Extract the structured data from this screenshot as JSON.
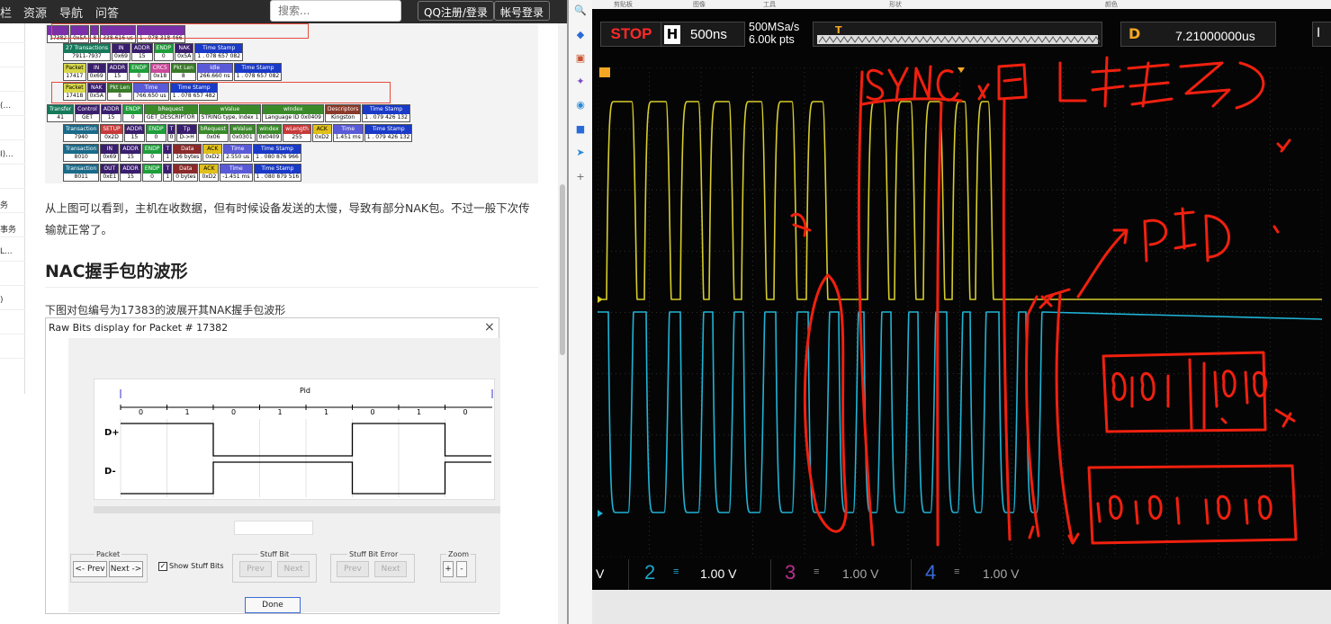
{
  "browser": {
    "nav": [
      "栏",
      "资源",
      "导航",
      "问答"
    ],
    "search_placeholder": "搜索...",
    "qq_login": "QQ注册/登录",
    "account_login": "帐号登录",
    "sidebar_items": [
      "",
      "",
      "",
      "(...",
      "",
      "I)...",
      "",
      "务",
      "事务",
      "L...",
      "",
      ")",
      "",
      ""
    ]
  },
  "article": {
    "trace_rows": [
      {
        "cells": [
          {
            "h": "",
            "v": "17382",
            "c": "#7b2fa8"
          },
          {
            "h": "",
            "v": "0x5A",
            "c": "#7b2fa8"
          },
          {
            "h": "",
            "v": "8",
            "c": "#7b2fa8"
          },
          {
            "h": "",
            "v": "338.616 us",
            "c": "#7b2fa8"
          },
          {
            "h": "",
            "v": "1 . 078 318 466",
            "c": "#7b2fa8"
          }
        ]
      },
      {
        "cells": [
          {
            "h": "27 Transactions",
            "v": "7911-7937",
            "c": "#167a5a"
          },
          {
            "h": "IN",
            "v": "0x69",
            "c": "#3a1e6e"
          },
          {
            "h": "ADDR",
            "v": "15",
            "c": "#3a1e6e"
          },
          {
            "h": "ENDP",
            "v": "0",
            "c": "#1e9e3a"
          },
          {
            "h": "NAK",
            "v": "0x5A",
            "c": "#3a1e6e"
          },
          {
            "h": "Time Stamp",
            "v": "1 . 078 657 082",
            "c": "#1a3ac8"
          }
        ]
      },
      {
        "cells": [
          {
            "h": "Packet",
            "v": "17417",
            "c": "#d8d84a"
          },
          {
            "h": "IN",
            "v": "0x69",
            "c": "#3a1e6e"
          },
          {
            "h": "ADDR",
            "v": "15",
            "c": "#3a1e6e"
          },
          {
            "h": "ENDP",
            "v": "0",
            "c": "#1e9e3a"
          },
          {
            "h": "CRC5",
            "v": "0x18",
            "c": "#c94a9a"
          },
          {
            "h": "Pkt Len",
            "v": "8",
            "c": "#3a7a2a"
          },
          {
            "h": "Idle",
            "v": "266.660 ns",
            "c": "#5a5ad8"
          },
          {
            "h": "Time Stamp",
            "v": "1 . 078 657 082",
            "c": "#1a3ac8"
          }
        ]
      },
      {
        "cells": [
          {
            "h": "Packet",
            "v": "17418",
            "c": "#d8d84a"
          },
          {
            "h": "NAK",
            "v": "0x5A",
            "c": "#3a1e6e"
          },
          {
            "h": "Pkt Len",
            "v": "8",
            "c": "#3a7a2a"
          },
          {
            "h": "Time",
            "v": "766.650 us",
            "c": "#5a5ad8"
          },
          {
            "h": "Time Stamp",
            "v": "1 . 078 657 482",
            "c": "#1a3ac8"
          }
        ]
      },
      {
        "cells": [
          {
            "h": "Transfer",
            "v": "41",
            "c": "#167a5a"
          },
          {
            "h": "Control",
            "v": "GET",
            "c": "#3a1e6e"
          },
          {
            "h": "ADDR",
            "v": "15",
            "c": "#3a1e6e"
          },
          {
            "h": "ENDP",
            "v": "0",
            "c": "#1e9e3a"
          },
          {
            "h": "bRequest",
            "v": "GET_DESCRIPTOR",
            "c": "#3a8a2a"
          },
          {
            "h": "wValue",
            "v": "STRING type, Index 1",
            "c": "#3a8a2a"
          },
          {
            "h": "wIndex",
            "v": "Language ID 0x0409",
            "c": "#3a8a2a"
          },
          {
            "h": "Descriptors",
            "v": "Kingston",
            "c": "#8a3a2a"
          },
          {
            "h": "Time Stamp",
            "v": "1 . 079 426 132",
            "c": "#1a3ac8"
          }
        ]
      },
      {
        "cells": [
          {
            "h": "Transaction",
            "v": "7940",
            "c": "#1a6a8a"
          },
          {
            "h": "SETUP",
            "v": "0x2D",
            "c": "#c83a3a"
          },
          {
            "h": "ADDR",
            "v": "15",
            "c": "#3a1e6e"
          },
          {
            "h": "ENDP",
            "v": "0",
            "c": "#1e9e3a"
          },
          {
            "h": "T",
            "v": "0",
            "c": "#3a1e6e"
          },
          {
            "h": "Tp",
            "v": "D->H",
            "c": "#3a1e6e"
          },
          {
            "h": "bRequest",
            "v": "0x06",
            "c": "#3a8a2a"
          },
          {
            "h": "wValue",
            "v": "0x0301",
            "c": "#3a8a2a"
          },
          {
            "h": "wIndex",
            "v": "0x0409",
            "c": "#3a8a2a"
          },
          {
            "h": "wLength",
            "v": "255",
            "c": "#c83a3a"
          },
          {
            "h": "ACK",
            "v": "0xD2",
            "c": "#e0c01a"
          },
          {
            "h": "Time",
            "v": "1.451 ms",
            "c": "#5a5ad8"
          },
          {
            "h": "Time Stamp",
            "v": "1 . 079 426 132",
            "c": "#1a3ac8"
          }
        ]
      },
      {
        "cells": [
          {
            "h": "Transaction",
            "v": "8010",
            "c": "#1a6a8a"
          },
          {
            "h": "IN",
            "v": "0x69",
            "c": "#3a1e6e"
          },
          {
            "h": "ADDR",
            "v": "15",
            "c": "#3a1e6e"
          },
          {
            "h": "ENDP",
            "v": "0",
            "c": "#1e9e3a"
          },
          {
            "h": "T",
            "v": "1",
            "c": "#3a1e6e"
          },
          {
            "h": "Data",
            "v": "16 bytes",
            "c": "#8a2a2a"
          },
          {
            "h": "ACK",
            "v": "0xD2",
            "c": "#e0c01a"
          },
          {
            "h": "Time",
            "v": "2.550 us",
            "c": "#5a5ad8"
          },
          {
            "h": "Time Stamp",
            "v": "1 . 080 876 966",
            "c": "#1a3ac8"
          }
        ]
      },
      {
        "cells": [
          {
            "h": "Transaction",
            "v": "8011",
            "c": "#1a6a8a"
          },
          {
            "h": "OUT",
            "v": "0xE1",
            "c": "#3a1e6e"
          },
          {
            "h": "ADDR",
            "v": "15",
            "c": "#3a1e6e"
          },
          {
            "h": "ENDP",
            "v": "0",
            "c": "#1e9e3a"
          },
          {
            "h": "T",
            "v": "1",
            "c": "#3a1e6e"
          },
          {
            "h": "Data",
            "v": "0 bytes",
            "c": "#8a2a2a"
          },
          {
            "h": "ACK",
            "v": "0xD2",
            "c": "#e0c01a"
          },
          {
            "h": "Time",
            "v": "-1.451 ms",
            "c": "#5a5ad8"
          },
          {
            "h": "Time Stamp",
            "v": "1 . 080 879 516",
            "c": "#1a3ac8"
          }
        ]
      }
    ],
    "para1": "从上图可以看到，主机在收数据，但有时候设备发送的太慢，导致有部分NAK包。不过一般下次传输就正常了。",
    "heading": "NAC握手包的波形",
    "para2": "下图对包编号为17383的波展开其NAK握手包波形"
  },
  "dialog": {
    "title": "Raw Bits display for Packet # 17382",
    "close": "×",
    "pid_label": "Pid",
    "bits": [
      "0",
      "1",
      "0",
      "1",
      "1",
      "0",
      "1",
      "0"
    ],
    "d_plus": "D+",
    "d_minus": "D-",
    "groups": {
      "packet": {
        "title": "Packet",
        "prev": "<- Prev",
        "next": "Next ->"
      },
      "show_stuff": "Show Stuff Bits",
      "stuff_bit": {
        "title": "Stuff Bit",
        "prev": "Prev",
        "next": "Next"
      },
      "stuff_err": {
        "title": "Stuff Bit Error",
        "prev": "Prev",
        "next": "Next"
      },
      "zoom": {
        "title": "Zoom",
        "plus": "+",
        "minus": "-"
      }
    },
    "done": "Done"
  },
  "scope": {
    "menu": [
      "剪贴板",
      "图像",
      "工具",
      "形状",
      "颜色"
    ],
    "run_state": "STOP",
    "h_label": "H",
    "timebase": "500ns",
    "sample_rate": "500MSa/s",
    "points": "6.00k pts",
    "delay_label": "D",
    "delay": "7.21000000us",
    "channels": [
      {
        "num": "2",
        "scale": "1.00 V",
        "color": "#1fa3c8"
      },
      {
        "num": "3",
        "scale": "1.00 V",
        "color": "#c83aa8"
      },
      {
        "num": "4",
        "scale": "1.00 V",
        "color": "#3a6ad8"
      }
    ],
    "ch1_scale_tail": "V",
    "colors": {
      "ch1": "#d6cd2c",
      "ch2": "#1fb4d6",
      "ink": "#f0200f",
      "grid": "#3a3a3a"
    }
  }
}
